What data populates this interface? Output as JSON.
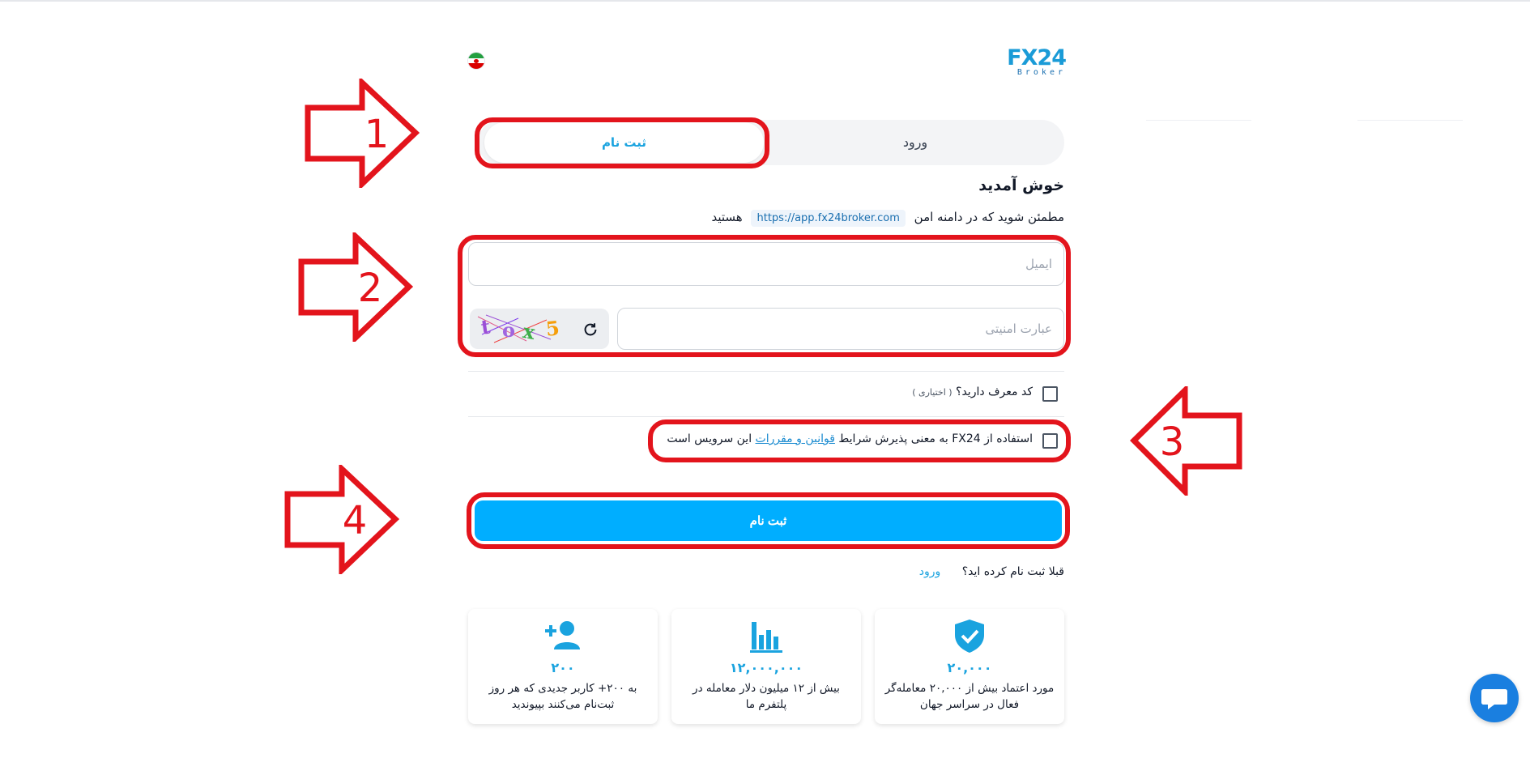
{
  "header": {
    "logo_main": "FX24",
    "logo_sub": "Broker",
    "language_flag": "iran-flag"
  },
  "tabs": {
    "register_label": "ثبت نام",
    "login_label": "ورود"
  },
  "welcome": "خوش آمدید",
  "security_notice": {
    "before": "مطمئن شوید که در دامنه امن",
    "domain": "https://app.fx24broker.com",
    "after": "هستید"
  },
  "form": {
    "email_placeholder": "ایمیل",
    "captcha_placeholder": "عبارت امنیتی",
    "captcha_chars": [
      "t",
      "o",
      "x",
      "5"
    ],
    "captcha_colors": [
      "#9b4fd6",
      "#a066e0",
      "#3fae49",
      "#f59e0b"
    ],
    "referral_label": "کد معرف دارید؟",
    "referral_optional": "( اختیاری )",
    "terms_before": "استفاده از FX24 به معنی پذیرش شرایط",
    "terms_link": "قوانین و مقررات",
    "terms_after": "این سرویس است",
    "submit_label": "ثبت نام",
    "already_text": "قبلا ثبت نام کرده اید؟",
    "login_link": "ورود"
  },
  "stats": [
    {
      "icon": "verified-shield-icon",
      "value": "۲۰,۰۰۰",
      "text": "مورد اعتماد بیش از ۲۰,۰۰۰ معامله‌گر فعال در سراسر جهان"
    },
    {
      "icon": "bar-chart-icon",
      "value": "۱۲,۰۰۰,۰۰۰",
      "text": "بیش از ۱۲ میلیون دلار معامله در پلتفرم ما"
    },
    {
      "icon": "add-user-icon",
      "value": "۲۰۰",
      "text": "به ۲۰۰+ کاربر جدیدی که هر روز ثبت‌نام می‌کنند بپیوندید"
    }
  ],
  "annotations": {
    "labels": [
      "1",
      "2",
      "3",
      "4"
    ],
    "color": "#e3141c"
  },
  "colors": {
    "accent": "#00aeff",
    "link": "#1aa3df"
  }
}
